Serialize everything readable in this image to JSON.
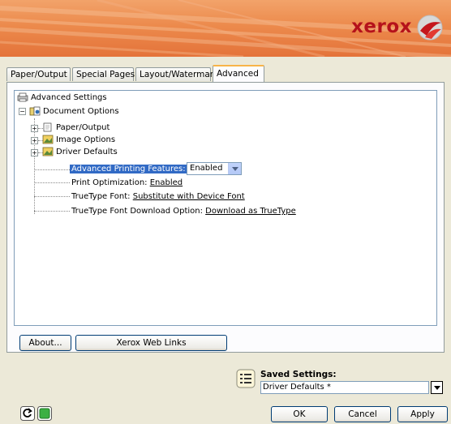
{
  "brand": {
    "name": "xerox"
  },
  "tabs": [
    {
      "label": "Paper/Output"
    },
    {
      "label": "Special Pages"
    },
    {
      "label": "Layout/Watermark"
    },
    {
      "label": "Advanced"
    }
  ],
  "tree": {
    "root": "Advanced Settings",
    "document_options": "Document Options",
    "paper_output": "Paper/Output",
    "image_options": "Image Options",
    "driver_defaults": "Driver Defaults",
    "advanced_printing": {
      "label": "Advanced Printing Features:",
      "value": "Enabled"
    },
    "print_optimization": {
      "label": "Print Optimization: ",
      "value": "Enabled"
    },
    "truetype_font": {
      "label": "TrueType Font: ",
      "value": "Substitute with Device Font"
    },
    "truetype_download": {
      "label": "TrueType Font Download Option: ",
      "value": "Download as TrueType"
    }
  },
  "buttons": {
    "about": "About...",
    "web_links": "Xerox Web Links",
    "ok": "OK",
    "cancel": "Cancel",
    "apply": "Apply"
  },
  "saved_settings": {
    "label": "Saved Settings:",
    "value": "Driver Defaults *"
  },
  "colors": {
    "banner": "#ec8a4c",
    "logo": "#b5121b",
    "selection": "#316ac5"
  }
}
